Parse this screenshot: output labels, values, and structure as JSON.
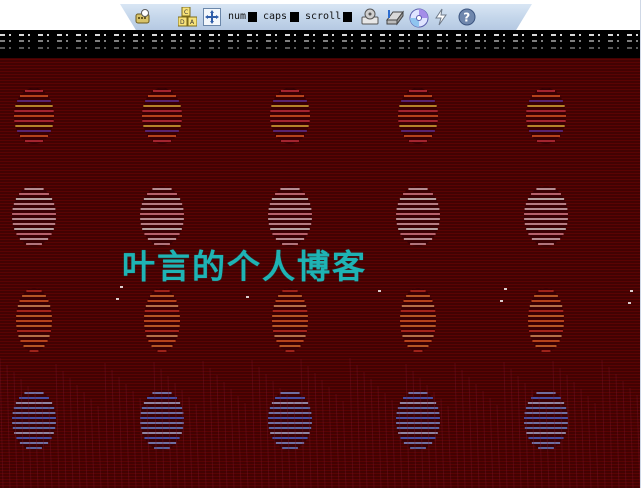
{
  "toolbar": {
    "num_label": "num",
    "caps_label": "caps",
    "scroll_label": "scroll",
    "ctrl_alt_del_letters": "CAD",
    "icons": [
      "keyboard-icon",
      "ctrl-alt-del-icon",
      "move-icon",
      "floppy-icon",
      "drive-icon",
      "cdrom-icon",
      "power-icon",
      "help-icon"
    ]
  },
  "desktop": {
    "title": "叶言的个人博客",
    "colors": {
      "background": "#5a0303",
      "title": "#1fb3b4",
      "toolbar": "#c3d5ea"
    }
  }
}
